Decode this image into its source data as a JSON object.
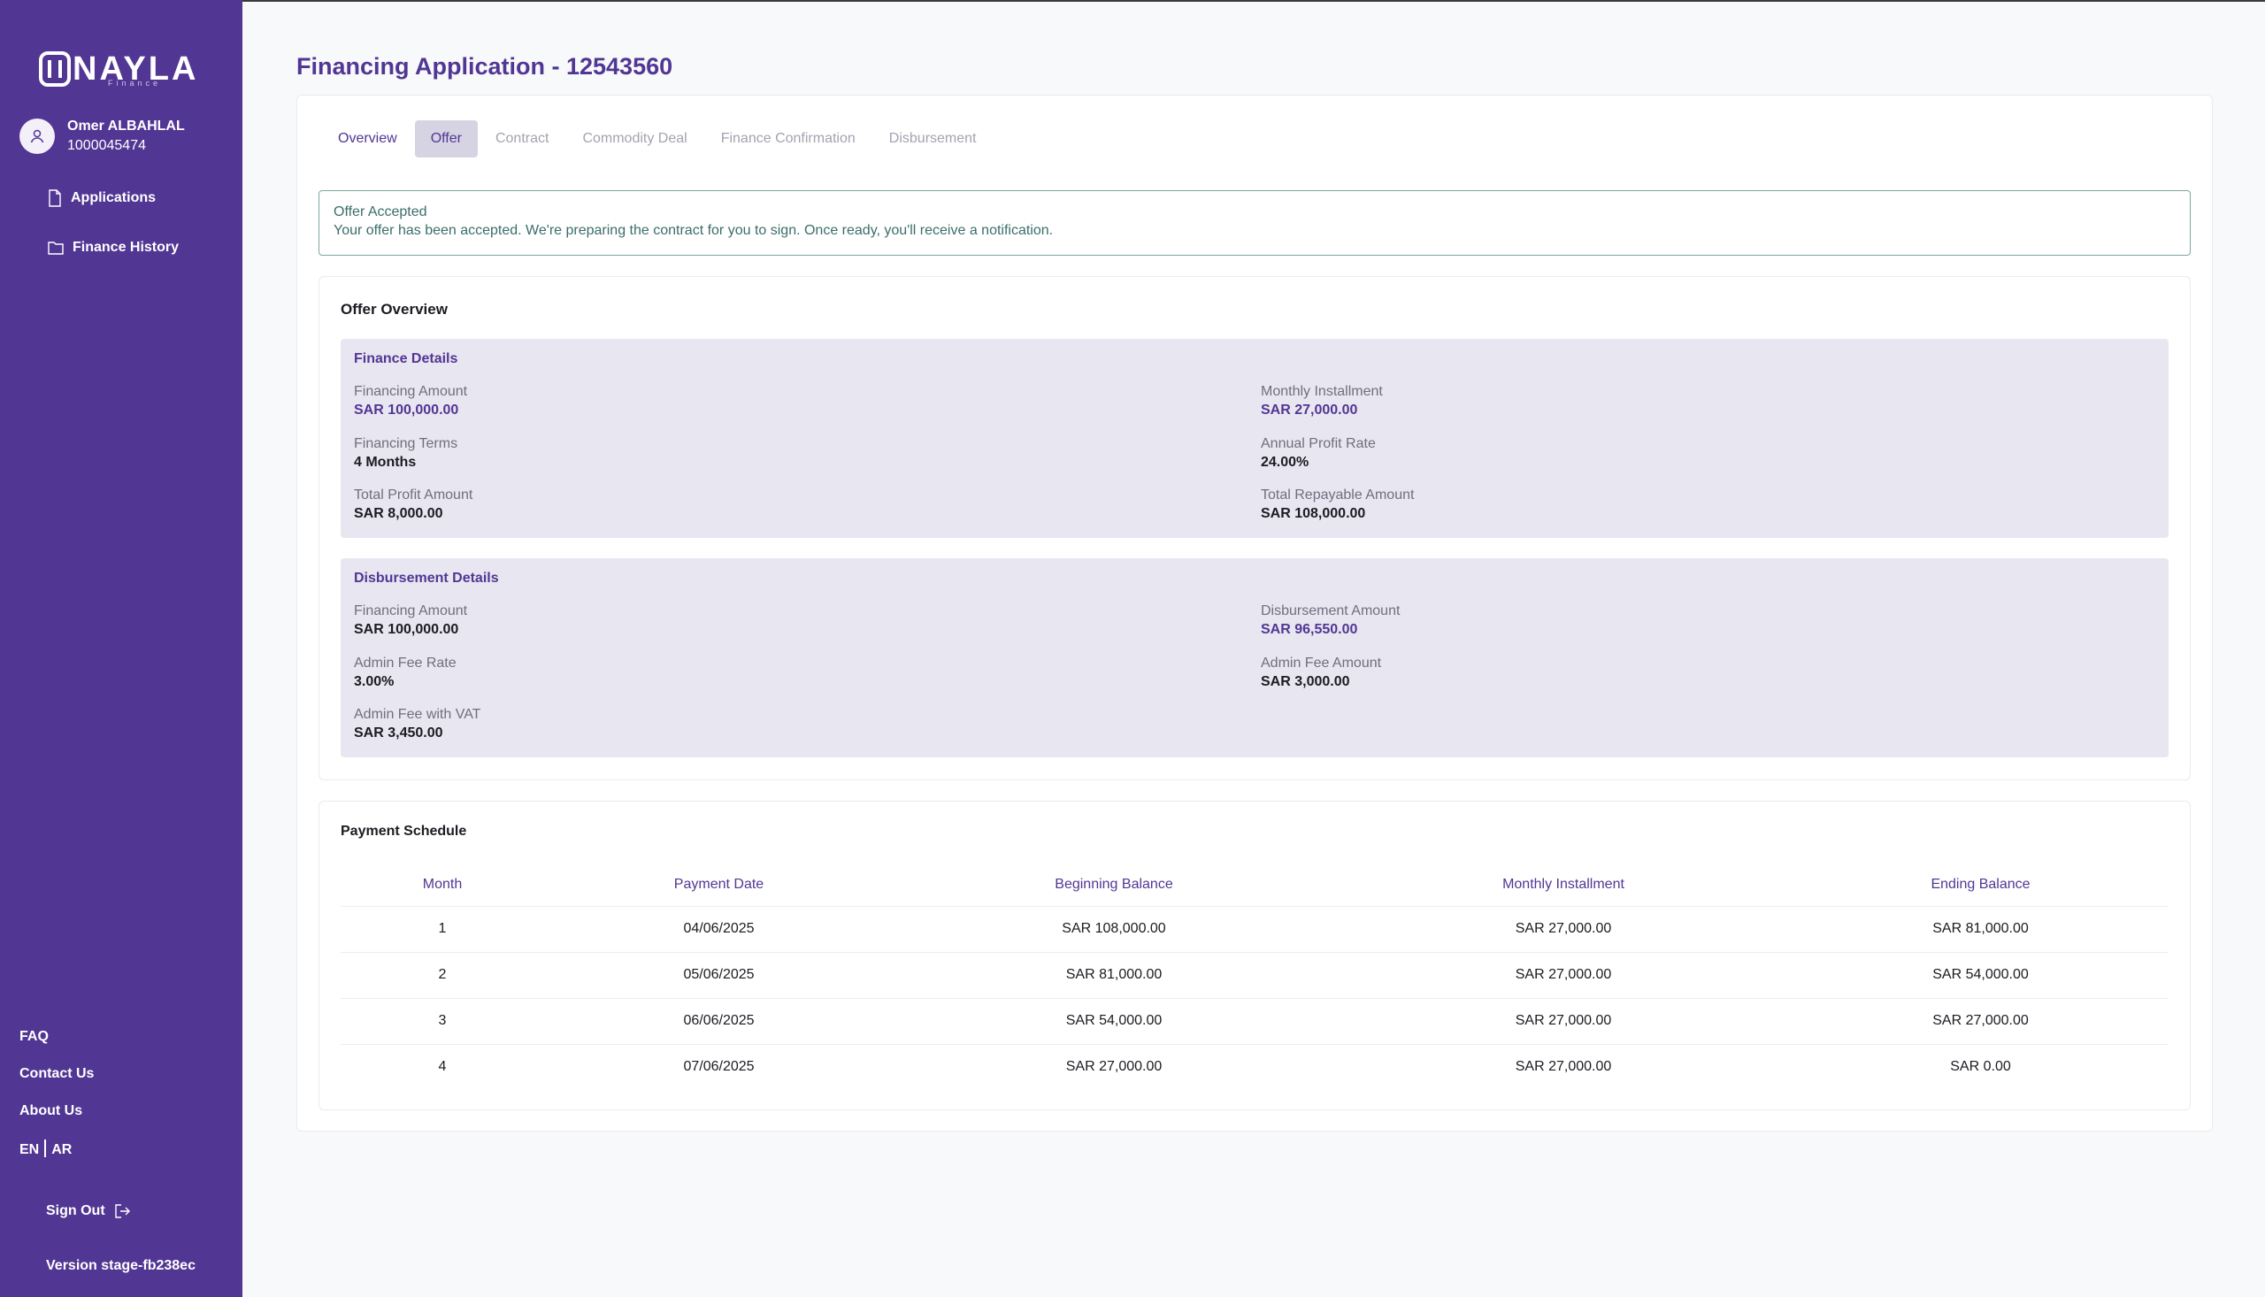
{
  "sidebar": {
    "logo": "NAYLA",
    "logo_sub": "Finance",
    "user_name": "Omer ALBAHLAL",
    "user_id": "1000045474",
    "nav": [
      {
        "label": "Applications",
        "icon": "document-icon"
      },
      {
        "label": "Finance History",
        "icon": "folder-icon"
      }
    ],
    "faq": "FAQ",
    "contact": "Contact Us",
    "about": "About Us",
    "lang_en": "EN",
    "lang_ar": "AR",
    "sign_out": "Sign Out",
    "version": "Version stage-fb238ec"
  },
  "page": {
    "title": "Financing Application - 12543560"
  },
  "tabs": [
    "Overview",
    "Offer",
    "Contract",
    "Commodity Deal",
    "Finance Confirmation",
    "Disbursement"
  ],
  "alert": {
    "title": "Offer Accepted",
    "text": "Your offer has been accepted. We're preparing the contract for you to sign. Once ready, you'll receive a notification."
  },
  "offer": {
    "title": "Offer Overview",
    "finance": {
      "title": "Finance Details",
      "financing_amount_label": "Financing Amount",
      "financing_amount": "SAR 100,000.00",
      "monthly_installment_label": "Monthly Installment",
      "monthly_installment": "SAR 27,000.00",
      "terms_label": "Financing Terms",
      "terms": "4 Months",
      "rate_label": "Annual Profit Rate",
      "rate": "24.00%",
      "total_profit_label": "Total Profit Amount",
      "total_profit": "SAR 8,000.00",
      "total_repayable_label": "Total Repayable Amount",
      "total_repayable": "SAR 108,000.00"
    },
    "disbursement": {
      "title": "Disbursement Details",
      "financing_amount_label": "Financing Amount",
      "financing_amount": "SAR 100,000.00",
      "disbursement_amount_label": "Disbursement Amount",
      "disbursement_amount": "SAR 96,550.00",
      "admin_fee_rate_label": "Admin Fee Rate",
      "admin_fee_rate": "3.00%",
      "admin_fee_amount_label": "Admin Fee Amount",
      "admin_fee_amount": "SAR 3,000.00",
      "admin_fee_vat_label": "Admin Fee with VAT",
      "admin_fee_vat": "SAR 3,450.00"
    }
  },
  "schedule": {
    "title": "Payment Schedule",
    "headers": [
      "Month",
      "Payment Date",
      "Beginning Balance",
      "Monthly Installment",
      "Ending Balance"
    ],
    "rows": [
      [
        "1",
        "04/06/2025",
        "SAR 108,000.00",
        "SAR 27,000.00",
        "SAR 81,000.00"
      ],
      [
        "2",
        "05/06/2025",
        "SAR 81,000.00",
        "SAR 27,000.00",
        "SAR 54,000.00"
      ],
      [
        "3",
        "06/06/2025",
        "SAR 54,000.00",
        "SAR 27,000.00",
        "SAR 27,000.00"
      ],
      [
        "4",
        "07/06/2025",
        "SAR 27,000.00",
        "SAR 27,000.00",
        "SAR 0.00"
      ]
    ]
  }
}
